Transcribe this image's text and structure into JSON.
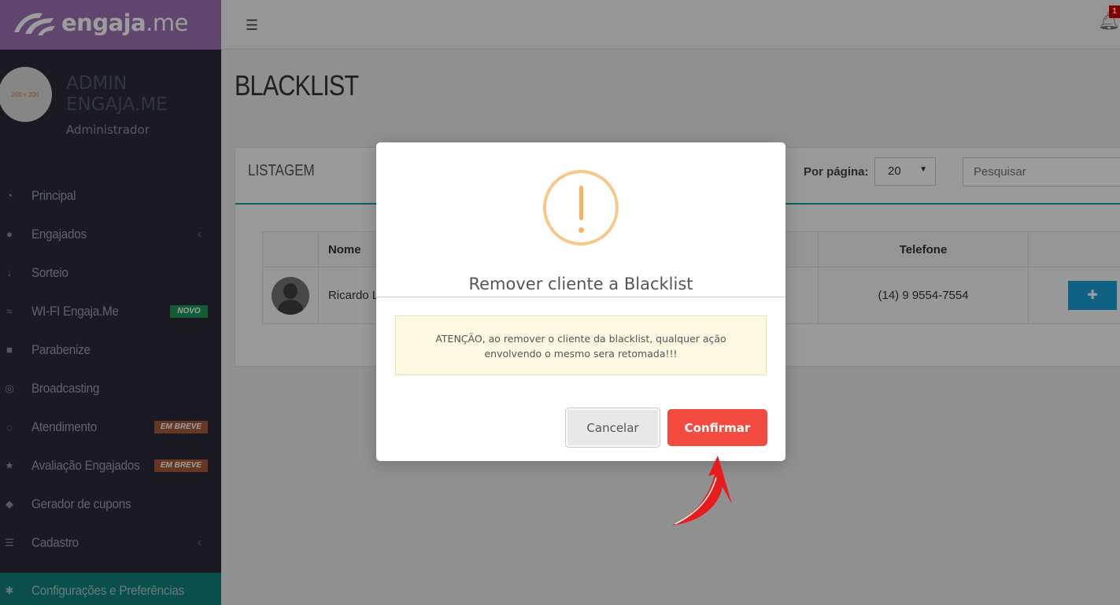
{
  "brand": {
    "bold": "engaja",
    "light": ".me"
  },
  "profile": {
    "avatar_text": "200 x 200",
    "name": "ADMIN ENGAJA.ME",
    "role": "Administrador"
  },
  "nav": [
    {
      "label": "Principal",
      "icon": "dashboard-icon"
    },
    {
      "label": "Engajados",
      "icon": "users-icon",
      "chevron": "‹"
    },
    {
      "label": "Sorteio",
      "icon": "sort-numeric-icon"
    },
    {
      "label": "WI-FI Engaja.Me",
      "icon": "wifi-icon",
      "badge": "NOVO"
    },
    {
      "label": "Parabenize",
      "icon": "gift-icon"
    },
    {
      "label": "Broadcasting",
      "icon": "broadcast-icon"
    },
    {
      "label": "Atendimento",
      "icon": "chat-icon",
      "badge": "EM BREVE"
    },
    {
      "label": "Avaliação Engajados",
      "icon": "star-icon",
      "badge": "EM BREVE"
    },
    {
      "label": "Gerador de cupons",
      "icon": "ticket-icon"
    },
    {
      "label": "Cadastro",
      "icon": "sliders-icon",
      "chevron": "‹"
    },
    {
      "label": "Configurações e Preferências",
      "icon": "gear-icon"
    }
  ],
  "topbar": {
    "notifications": "1"
  },
  "page": {
    "title": "BLACKLIST"
  },
  "panel": {
    "title": "LISTAGEM",
    "per_page_label": "Por página:",
    "per_page_value": "20",
    "search_placeholder": "Pesquisar"
  },
  "table": {
    "headers": [
      "",
      "Nome",
      "Telefone",
      ""
    ],
    "rows": [
      {
        "nome": "Ricardo L",
        "telefone": "(14) 9 9554-7554"
      }
    ]
  },
  "modal": {
    "title": "Remover cliente a Blacklist",
    "message": "ATENÇÃO, ao remover o cliente da blacklist, qualquer ação envolvendo o mesmo sera retomada!!!",
    "cancel_label": "Cancelar",
    "confirm_label": "Confirmar"
  },
  "colors": {
    "sidebar_bg": "#2a2c38",
    "brand_bg": "#9d73b6",
    "active_nav": "#11827a",
    "confirm": "#f34b3f",
    "warning": "#f8c78b",
    "add_button": "#1aa0d6"
  }
}
